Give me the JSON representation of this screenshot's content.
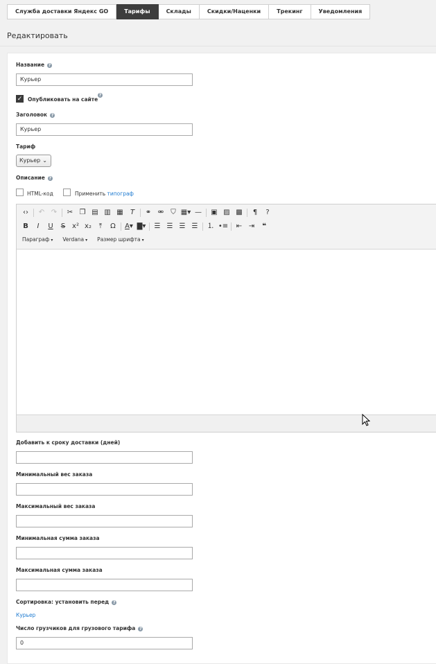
{
  "tabs": [
    "Служба доставки Яндекс GO",
    "Тарифы",
    "Склады",
    "Скидки/Наценки",
    "Трекинг",
    "Уведомления"
  ],
  "active_tab": "Тарифы",
  "section_title": "Редактировать",
  "form": {
    "name_label": "Название",
    "name_value": "Курьер",
    "publish_label": "Опубликовать на сайте",
    "heading_label": "Заголовок",
    "heading_value": "Курьер",
    "tariff_label": "Тариф",
    "tariff_value": "Курьер",
    "description_label": "Описание",
    "html_code_label": "HTML-код",
    "apply_label": "Применить",
    "typograph_link": "типограф",
    "editor_menus": [
      "Параграф",
      "Verdana",
      "Размер шрифта"
    ],
    "add_days_label": "Добавить к сроку доставки (дней)",
    "add_days_value": "",
    "min_weight_label": "Минимальный вес заказа",
    "min_weight_value": "",
    "max_weight_label": "Максимальный вес заказа",
    "max_weight_value": "",
    "min_sum_label": "Минимальная сумма заказа",
    "min_sum_value": "",
    "max_sum_label": "Максимальная сумма заказа",
    "max_sum_value": "",
    "sort_label": "Сортировка: установить перед",
    "sort_link": "Курьер",
    "loaders_label": "Число грузчиков для грузового тарифа",
    "loaders_value": "0"
  },
  "colors": {
    "active_tab_bg": "#3d3d3d",
    "link": "#1d7ad0",
    "help_icon": "#8a9aa8"
  }
}
